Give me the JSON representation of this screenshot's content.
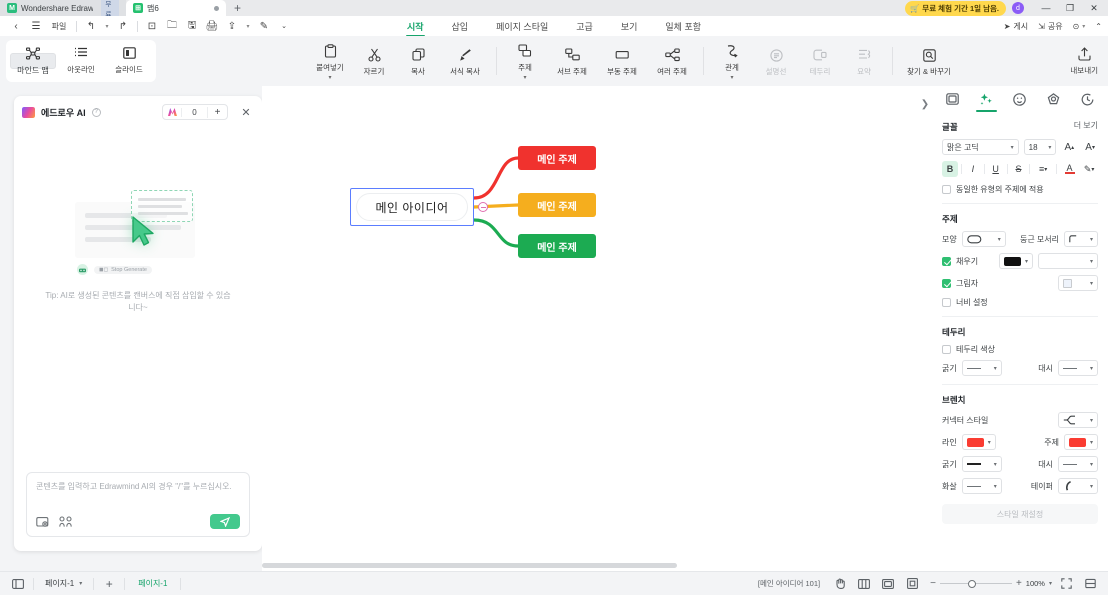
{
  "titlebar": {
    "home_tab": "Wondershare EdrawMind",
    "home_badge": "무료",
    "doc_tab": "맵6",
    "new_tab": "+",
    "trial": "무료 체험 기간 1일 남음.",
    "avatar": "d",
    "minimize": "—",
    "maximize": "❐",
    "close": "✕"
  },
  "quickbar": {
    "items": [
      {
        "name": "back-icon",
        "glyph": "‹"
      },
      {
        "name": "menu-icon",
        "glyph": "☰"
      },
      {
        "name": "file-label",
        "glyph": "파일"
      },
      {
        "name": "undo-icon",
        "glyph": "↰"
      },
      {
        "name": "redo-icon",
        "glyph": "↱"
      },
      {
        "name": "new-icon",
        "glyph": "⊡"
      },
      {
        "name": "open-icon",
        "glyph": "🗀"
      },
      {
        "name": "save-icon",
        "glyph": "🖫"
      },
      {
        "name": "print-icon",
        "glyph": "🖨"
      },
      {
        "name": "export-icon",
        "glyph": "⇪"
      },
      {
        "name": "edit-icon",
        "glyph": "✎"
      },
      {
        "name": "more-icon",
        "glyph": "⌄"
      }
    ]
  },
  "ribbon_tabs": {
    "items": [
      "시작",
      "삽입",
      "페이지 스타일",
      "고급",
      "보기",
      "일체 포함"
    ],
    "active": "시작",
    "right_items": [
      {
        "label": "게시",
        "icon": "send-icon"
      },
      {
        "label": "공유",
        "icon": "share-icon"
      },
      {
        "label": "",
        "icon": "help-icon"
      },
      {
        "label": "",
        "icon": "chevron-up-icon"
      }
    ]
  },
  "view_group": {
    "items": [
      {
        "label": "마인드 맵",
        "icon": "mindmap-icon",
        "selected": true
      },
      {
        "label": "아웃라인",
        "icon": "outline-icon",
        "selected": false
      },
      {
        "label": "슬라이드",
        "icon": "slide-icon",
        "selected": false
      }
    ]
  },
  "toolbar": {
    "items": [
      {
        "label": "붙여넣기",
        "icon": "paste-icon",
        "dropdown": true,
        "disabled": false
      },
      {
        "label": "자르기",
        "icon": "cut-icon",
        "dropdown": false,
        "disabled": false
      },
      {
        "label": "복사",
        "icon": "copy-icon",
        "dropdown": false,
        "disabled": false
      },
      {
        "label": "서식 복사",
        "icon": "format-painter-icon",
        "dropdown": false,
        "disabled": false
      },
      {
        "label": "주제",
        "icon": "topic-icon",
        "dropdown": true,
        "disabled": false
      },
      {
        "label": "서브 주제",
        "icon": "subtopic-icon",
        "dropdown": false,
        "disabled": false
      },
      {
        "label": "부동 주제",
        "icon": "floating-topic-icon",
        "dropdown": false,
        "disabled": false
      },
      {
        "label": "여러 주제",
        "icon": "multi-topic-icon",
        "dropdown": false,
        "disabled": false
      },
      {
        "label": "관계",
        "icon": "relationship-icon",
        "dropdown": true,
        "disabled": false
      },
      {
        "label": "설명선",
        "icon": "callout-icon",
        "dropdown": false,
        "disabled": true
      },
      {
        "label": "테두리",
        "icon": "boundary-icon",
        "dropdown": false,
        "disabled": true
      },
      {
        "label": "요약",
        "icon": "summary-icon",
        "dropdown": false,
        "disabled": true
      },
      {
        "label": "찾기 & 바꾸기",
        "icon": "find-replace-icon",
        "dropdown": false,
        "disabled": false
      }
    ],
    "export": {
      "label": "내보내기",
      "icon": "export-icon"
    }
  },
  "ai_panel": {
    "title": "에드로우 AI",
    "help_icon": "question-icon",
    "credits": "0",
    "plus": "+",
    "close": "✕",
    "stop_generate": "Stop Generate",
    "tip": "Tip: AI로 생성된 콘텐츠를 캔버스에 직접 삽입할 수 있습니다~",
    "input_placeholder": "콘텐츠를 입력하고 Edrawmind AI의 경우 \"/\"를 누르십시오.",
    "send_icon": "send-icon"
  },
  "canvas": {
    "central_topic": "메인 아이디어",
    "main_topics": [
      {
        "label": "메인 주제",
        "color": "#f0322e"
      },
      {
        "label": "메인 주제",
        "color": "#f5ae1e"
      },
      {
        "label": "메인 주제",
        "color": "#1cab52"
      }
    ]
  },
  "right_panel": {
    "tabs": [
      {
        "name": "page-tab",
        "icon": "page-icon",
        "active": false
      },
      {
        "name": "style-tab",
        "icon": "sparkle-icon",
        "active": true
      },
      {
        "name": "emoji-tab",
        "icon": "emoji-icon",
        "active": false
      },
      {
        "name": "theme-tab",
        "icon": "flower-icon",
        "active": false
      },
      {
        "name": "history-tab",
        "icon": "clock-icon",
        "active": false
      }
    ],
    "font": {
      "title": "글꼴",
      "more": "더 보기",
      "family": "맑은 고딕",
      "size": "18",
      "grow": "A",
      "shrink": "A",
      "bold": "B",
      "italic": "I",
      "underline": "U",
      "strike": "S",
      "align": "≡",
      "text_color": "A",
      "highlight": "✎",
      "apply_same": "동일한 유형의 주제에 적용"
    },
    "topic": {
      "title": "주제",
      "shape_label": "모양",
      "corner_label": "둥근 모서리",
      "fill_label": "채우기",
      "fill_checked": true,
      "fill_color": "#111111",
      "shadow_label": "그림자",
      "shadow_checked": true,
      "width_label": "너비 설정",
      "width_checked": false
    },
    "border": {
      "title": "테두리",
      "color_label": "테두리 색상",
      "color_checked": false,
      "weight_label": "굵기",
      "dash_label": "대시"
    },
    "branch": {
      "title": "브렌치",
      "connector_label": "커넥터 스타일",
      "line_label": "라인",
      "line_color": "#fa3c32",
      "topic_label": "주제",
      "topic_color": "#fa3c32",
      "weight_label": "굵기",
      "dash_label": "대시",
      "arrow_label": "화살",
      "taper_label": "테이퍼",
      "reset_button": "스타일 재설정"
    }
  },
  "statusbar": {
    "page_icon": "page-view-icon",
    "page_select": "페이지-1",
    "add_page": "+",
    "page_tab": "페이지-1",
    "coords": "[메인 아이디어 101]",
    "tools": [
      {
        "name": "hand-tool-icon",
        "glyph": "✋"
      },
      {
        "name": "columns-icon",
        "glyph": "▥"
      },
      {
        "name": "layout-icon",
        "glyph": "▤"
      },
      {
        "name": "fit-icon",
        "glyph": "⛶"
      }
    ],
    "zoom_out": "−",
    "zoom_in": "+",
    "zoom_level": "100%",
    "fullscreen": "⛶",
    "split": "⊟"
  }
}
